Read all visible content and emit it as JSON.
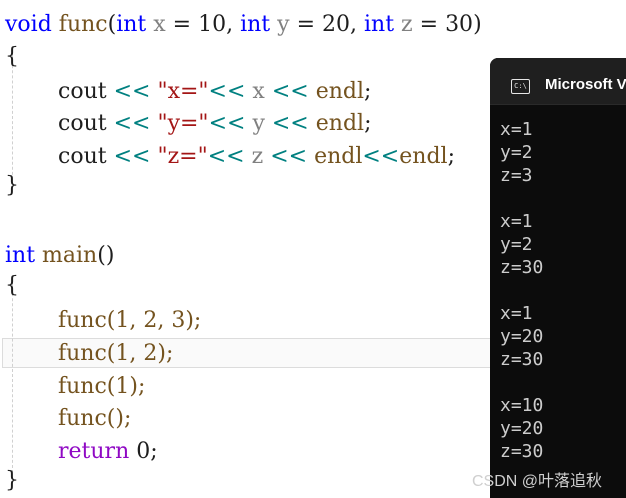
{
  "editor": {
    "lines": [
      {
        "kind": "sig",
        "t_kw_void": "void",
        "t_fn": "func",
        "t_lp": "(",
        "t_kw1": "int",
        "t_p1": "x",
        "t_eq1": " = ",
        "t_n1": "10",
        "t_c1": ", ",
        "t_kw2": "int",
        "t_p2": "y",
        "t_eq2": " = ",
        "t_n2": "20",
        "t_c2": ", ",
        "t_kw3": "int",
        "t_p3": "z",
        "t_eq3": " = ",
        "t_n3": "30",
        "t_rp": ")"
      },
      {
        "kind": "brace",
        "text": "{"
      },
      {
        "kind": "cout",
        "cout": "cout",
        "op1": "<<",
        "str": "\"x=\"",
        "op2": "<<",
        "var": "x",
        "op3": "<<",
        "endl": "endl",
        "tail": ";"
      },
      {
        "kind": "cout",
        "cout": "cout",
        "op1": "<<",
        "str": "\"y=\"",
        "op2": "<<",
        "var": "y",
        "op3": "<<",
        "endl": "endl",
        "tail": ";"
      },
      {
        "kind": "cout2",
        "cout": "cout",
        "op1": "<<",
        "str": "\"z=\"",
        "op2": "<<",
        "var": "z",
        "op3": "<<",
        "endl": "endl",
        "op4": "<<",
        "endl2": "endl",
        "tail": ";"
      },
      {
        "kind": "brace",
        "text": "}"
      },
      {
        "kind": "main",
        "kw": "int",
        "name": "main",
        "paren": "()"
      },
      {
        "kind": "brace",
        "text": "{"
      },
      {
        "kind": "call",
        "text": "func(1, 2, 3);"
      },
      {
        "kind": "call",
        "text": "func(1, 2);"
      },
      {
        "kind": "call",
        "text": "func(1);"
      },
      {
        "kind": "call",
        "text": "func();"
      },
      {
        "kind": "ret",
        "kw": "return",
        "rest": " 0;"
      },
      {
        "kind": "brace",
        "text": "}"
      }
    ]
  },
  "console": {
    "title": "Microsoft V",
    "icon": "console-window-icon",
    "icon_glyph": "C:\\",
    "output": [
      "x=1",
      "y=2",
      "z=3",
      "",
      "x=1",
      "y=2",
      "z=30",
      "",
      "x=1",
      "y=20",
      "z=30",
      "",
      "x=10",
      "y=20",
      "z=30"
    ]
  },
  "watermark": "CSDN @叶落追秋",
  "colors": {
    "keyword": "#0000ff",
    "function": "#74531f",
    "param": "#808080",
    "string": "#a31515",
    "operator": "#008080",
    "control": "#8f08c4",
    "console_bg": "#0c0c0c",
    "console_text": "#cccccc"
  }
}
